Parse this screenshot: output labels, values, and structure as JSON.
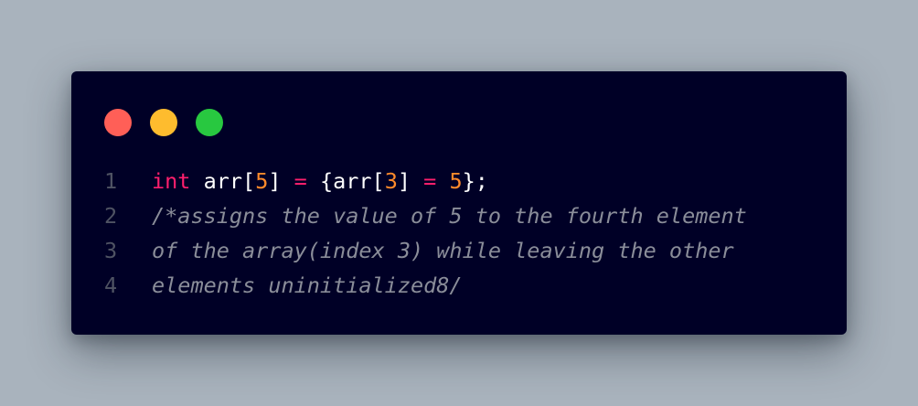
{
  "window": {
    "buttons": [
      {
        "name": "close",
        "color": "#ff5f57"
      },
      {
        "name": "minimize",
        "color": "#febc2e"
      },
      {
        "name": "maximize",
        "color": "#28c840"
      }
    ]
  },
  "code": {
    "lines": [
      {
        "number": "1",
        "tokens": [
          "int",
          " arr[",
          "5",
          "] ",
          "=",
          " {arr[",
          "3",
          "] ",
          "=",
          " ",
          "5",
          "};"
        ]
      },
      {
        "number": "2",
        "text": "/*assigns the value of 5 to the fourth element"
      },
      {
        "number": "3",
        "text": "of the array(index 3) while leaving the other"
      },
      {
        "number": "4",
        "text": "elements uninitialized8/"
      }
    ]
  }
}
